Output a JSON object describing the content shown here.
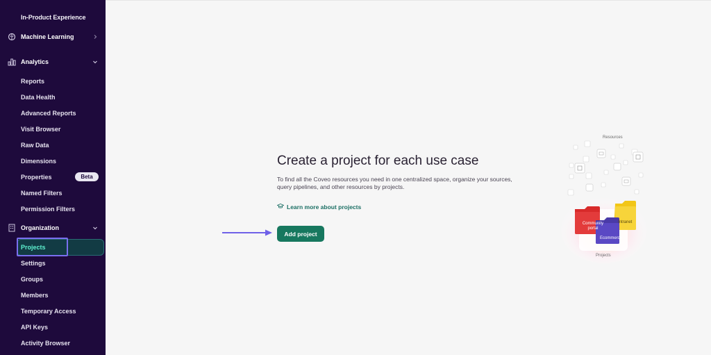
{
  "sidebar": {
    "top_item": "In-Product Experience",
    "sections": [
      {
        "label": "Machine Learning",
        "icon": "brain-icon",
        "chevron": "chevron-right-icon"
      },
      {
        "label": "Analytics",
        "icon": "chart-icon",
        "chevron": "chevron-down-icon"
      },
      {
        "label": "Organization",
        "icon": "building-icon",
        "chevron": "chevron-down-icon"
      }
    ],
    "analytics_items": [
      "Reports",
      "Data Health",
      "Advanced Reports",
      "Visit Browser",
      "Raw Data",
      "Dimensions",
      "Properties",
      "Named Filters",
      "Permission Filters"
    ],
    "properties_badge": "Beta",
    "organization_items": [
      "Projects",
      "Settings",
      "Groups",
      "Members",
      "Temporary Access",
      "API Keys",
      "Activity Browser"
    ],
    "active_item": "Projects"
  },
  "main": {
    "headline": "Create a project for each use case",
    "description": "To find all the Coveo resources you need in one centralized space, organize your sources, query pipelines, and other resources by projects.",
    "learn_link": "Learn more about projects",
    "add_button": "Add project"
  },
  "illustration": {
    "resources_label": "Resources",
    "projects_label": "Projects",
    "folders": [
      "Community portal",
      "Intranet",
      "Ecommerce"
    ]
  },
  "colors": {
    "sidebar_bg": "#1e0a3c",
    "accent_green": "#17785f",
    "active_text": "#5ef2d0",
    "highlight_border": "#7a6ff0"
  }
}
